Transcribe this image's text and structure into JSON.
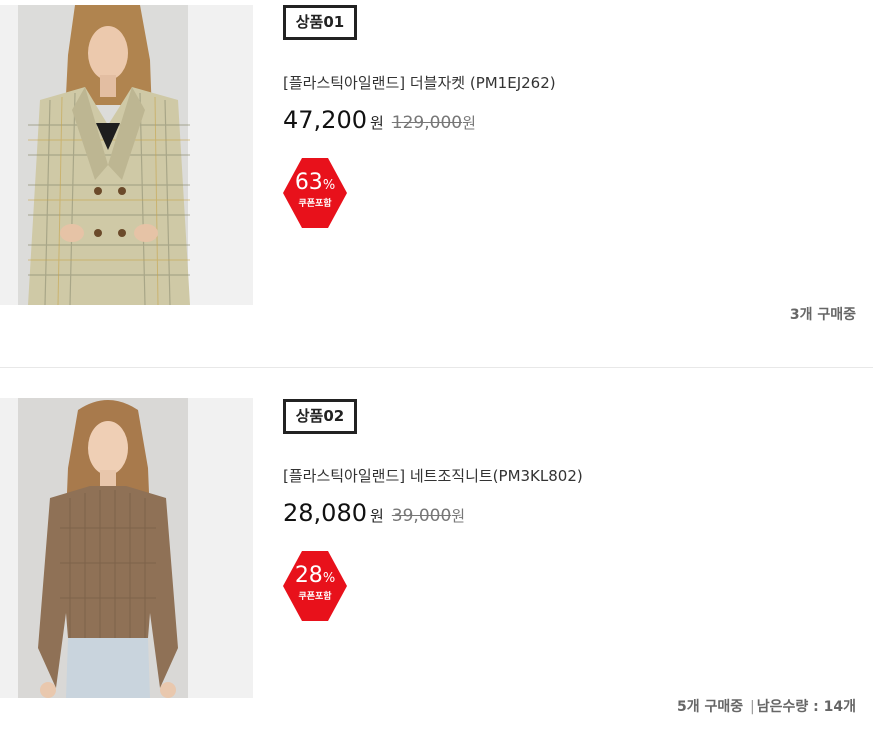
{
  "products": [
    {
      "badge": "상품01",
      "name": "[플라스틱아일랜드] 더블자켓 (PM1EJ262)",
      "price": "47,200",
      "price_unit": "원",
      "original_price": "129,000",
      "original_unit": "원",
      "discount_value": "63",
      "discount_sign": "%",
      "discount_note": "쿠폰포함",
      "purchase_count": "3개 구매중",
      "image_desc": "plaid-double-jacket"
    },
    {
      "badge": "상품02",
      "name": "[플라스틱아일랜드] 네트조직니트(PM3KL802)",
      "price": "28,080",
      "price_unit": "원",
      "original_price": "39,000",
      "original_unit": "원",
      "discount_value": "28",
      "discount_sign": "%",
      "discount_note": "쿠폰포함",
      "purchase_count": "5개 구매중",
      "separator": "|",
      "stock_label": "남은수량 : 14개",
      "image_desc": "brown-net-knit"
    }
  ],
  "colors": {
    "discount_badge": "#e8111b",
    "jacket_plaid": "#cfc9a6",
    "knit_brown": "#8f7156",
    "divider": "#e8e8e8"
  }
}
